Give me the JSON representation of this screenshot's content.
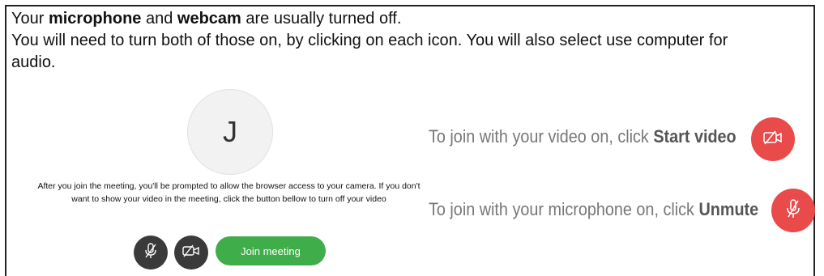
{
  "intro": {
    "line1_part1": "Your ",
    "line1_bold1": "microphone",
    "line1_part2": " and ",
    "line1_bold2": "webcam",
    "line1_part3": " are usually turned off.",
    "line2": "You will need to turn both of those on, by clicking on each icon. You will also select use computer for audio."
  },
  "preview": {
    "avatar_initial": "J",
    "prompt": "After you join the meeting, you'll be prompted to allow the browser access to your camera. If you don't want to show your video in the meeting, click the button bellow to turn off your video",
    "join_label": "Join meeting"
  },
  "tips": {
    "video_text": "To join with your video on, click ",
    "video_bold": "Start video",
    "mic_text": "To join with your microphone on, click ",
    "mic_bold": "Unmute"
  },
  "colors": {
    "red": "#e94a4a",
    "green": "#3fae4a",
    "dark": "#3a3a3a"
  },
  "icons": [
    "mic-muted-icon",
    "video-off-icon"
  ]
}
